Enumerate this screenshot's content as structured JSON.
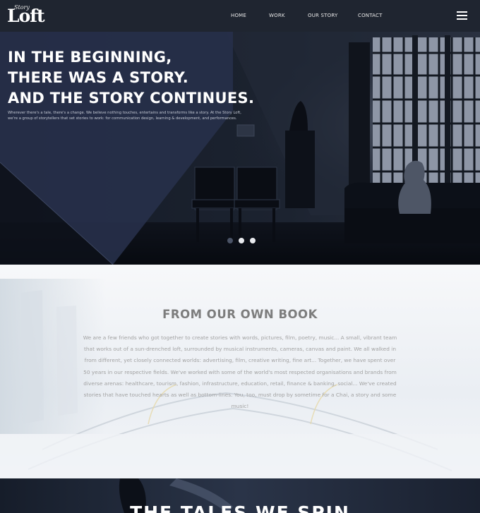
{
  "logo": {
    "small_text": "Story",
    "big_text": "Loft"
  },
  "nav": {
    "items": [
      {
        "label": "HOME"
      },
      {
        "label": "WORK"
      },
      {
        "label": "OUR STORY"
      },
      {
        "label": "CONTACT"
      }
    ]
  },
  "hero": {
    "title_lines": [
      "IN THE BEGINNING,",
      "THERE WAS A STORY.",
      "AND THE STORY CONTINUES."
    ],
    "description": "Wherever there's a tale, there's a change. We believe nothing touches, entertains and transforms like a story. At the Story Loft, we're a group of storytellers that set stories to work: for communication design, learning & development, and performances.",
    "slides": {
      "count": 3,
      "active_index": 0
    }
  },
  "book": {
    "heading": "FROM OUR OWN BOOK",
    "text": "We are a few friends who got together to create stories with words, pictures, film, poetry, music... A small, vibrant team that works out of a sun-drenched loft, surrounded by musical instruments, cameras, canvas and paint. We all walked in from different, yet closely connected worlds: advertising, film, creative writing, fine art... Together, we have spent over 50 years in our respective fields. We've worked with some of the world's most respected organisations and brands from diverse arenas: healthcare, tourism, fashion, infrastructure, education, retail, finance & banking, social... We've created stories that have touched hearts as well as bottom-lines. You, too, must drop by sometime for a Chai, a story and some music!"
  },
  "tales": {
    "heading": "THE TALES WE SPIN"
  },
  "colors": {
    "nav_bg": "#1f2530",
    "hero_overlay": "#27304a",
    "heading_grey": "#7d7d7d",
    "body_grey": "#a2a2a2"
  }
}
